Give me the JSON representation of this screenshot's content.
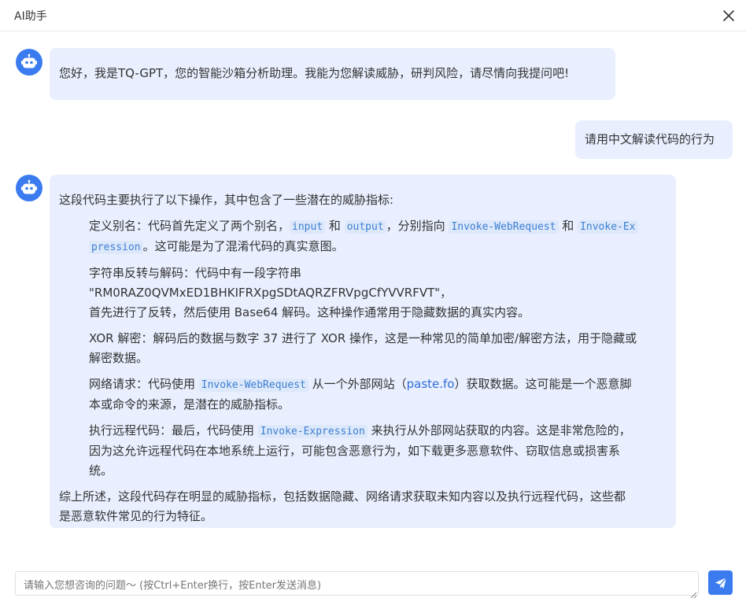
{
  "window": {
    "title": "AI助手"
  },
  "messages": {
    "greeting": "您好，我是TQ-GPT，您的智能沙箱分析助理。我能为您解读威胁，研判风险，请尽情向我提问吧!",
    "user_question": "请用中文解读代码的行为",
    "answer": {
      "intro": "这段代码主要执行了以下操作，其中包含了一些潜在的威胁指标:",
      "item1": {
        "prefix": "定义别名：代码首先定义了两个别名，",
        "code1": "input",
        "and1": " 和 ",
        "code2": "output",
        "mid": "，分别指向 ",
        "code3": "Invoke-WebRequest",
        "and2": " 和 ",
        "code4a": "Invoke-Ex",
        "code4b": "pression",
        "suffix": "。这可能是为了混淆代码的真实意图。"
      },
      "item2": {
        "line1": "字符串反转与解码：代码中有一段字符串 \"RM0RAZ0QVMxED1BHKIFRXpgSDtAQRZFRVpgCfYVVRFVT\"，",
        "line2": "首先进行了反转，然后使用 Base64 解码。这种操作通常用于隐藏数据的真实内容。"
      },
      "item3": {
        "line1": "XOR 解密：解码后的数据与数字 37 进行了 XOR 操作，这是一种常见的简单加密/解密方法，用于隐藏或",
        "line2": "解密数据。"
      },
      "item4": {
        "prefix": "网络请求：代码使用 ",
        "code": "Invoke-WebRequest",
        "mid": " 从一个外部网站（",
        "link": "paste.fo",
        "suffix": "）获取数据。这可能是一个恶意脚",
        "line2": "本或命令的来源，是潜在的威胁指标。"
      },
      "item5": {
        "prefix": "执行远程代码：最后，代码使用 ",
        "code": "Invoke-Expression",
        "suffix": " 来执行从外部网站获取的内容。这是非常危险的，",
        "line2": "因为这允许远程代码在本地系统上运行，可能包含恶意行为，如下载更多恶意软件、窃取信息或损害系",
        "line3": "统。"
      },
      "conclusion1": "综上所述，这段代码存在明显的威胁指标，包括数据隐藏、网络请求获取未知内容以及执行远程代码，这些都",
      "conclusion2": "是恶意软件常见的行为特征。"
    }
  },
  "composer": {
    "placeholder": "请输入您想咨询的问题～ (按Ctrl+Enter换行，按Enter发送消息)"
  },
  "icons": {
    "avatar": "robot-icon",
    "close": "close-icon",
    "send": "send-icon"
  },
  "colors": {
    "accent": "#3a7bf0",
    "bubble": "#e9efff",
    "code": "#3c7fd1"
  }
}
